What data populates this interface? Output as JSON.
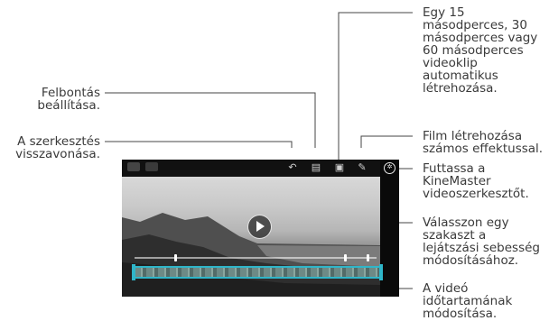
{
  "callouts": {
    "auto_clip": "Egy 15 másodperces, 30 másodperces vagy 60 másodperces videoklip automatikus létrehozása.",
    "resolution": "Felbontás beállítása.",
    "undo": "A szerkesztés visszavonása.",
    "effects": "Film létrehozása számos effektussal.",
    "kinemaster": "Futtassa a KineMaster videoszerkesztőt.",
    "speed": "Válasszon egy szakaszt a lejátszási sebesség módosításához.",
    "duration": "A videó időtartamának módosítása."
  },
  "callout_lines_arr": {
    "auto_clip": [
      "Egy 15",
      "másodperces, 30",
      "másodperces vagy",
      "60 másodperces",
      "videoklip",
      "automatikus",
      "létrehozása."
    ],
    "resolution": [
      "Felbontás",
      "beállítása."
    ],
    "undo": [
      "A szerkesztés",
      "visszavonása."
    ],
    "effects": [
      "Film létrehozása",
      "számos effektussal."
    ],
    "kinemaster": [
      "Futtassa a",
      "KineMaster",
      "videoszerkesztőt."
    ],
    "speed": [
      "Válasszon egy",
      "szakaszt a",
      "lejátszási sebesség",
      "módosításához."
    ],
    "duration": [
      "A videó",
      "időtartamának",
      "módosítása."
    ]
  },
  "toolbar": {
    "icons": [
      "undo-icon",
      "resolution-icon",
      "auto-clip-icon",
      "effects-icon",
      "kinemaster-icon"
    ]
  },
  "colors": {
    "accent": "#2fb6c9",
    "callout_line": "#444444"
  }
}
